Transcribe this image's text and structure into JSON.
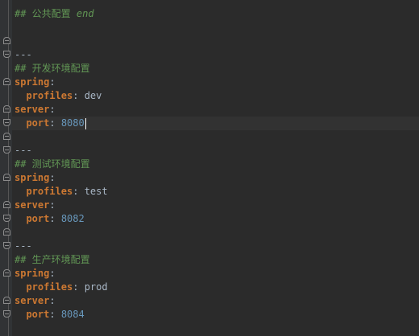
{
  "editor": {
    "lines": [
      {
        "id": "l01",
        "tokens": [
          {
            "cls": "comment",
            "text": "## 公共配置 "
          },
          {
            "cls": "comment-italic",
            "text": "end"
          }
        ]
      },
      {
        "id": "l02",
        "tokens": []
      },
      {
        "id": "l03",
        "tokens": []
      },
      {
        "id": "l04",
        "tokens": [
          {
            "cls": "dash",
            "text": "---"
          }
        ]
      },
      {
        "id": "l05",
        "tokens": [
          {
            "cls": "comment",
            "text": "## 开发环境配置"
          }
        ]
      },
      {
        "id": "l06",
        "tokens": [
          {
            "cls": "key",
            "text": "spring"
          },
          {
            "cls": "plain",
            "text": ":"
          }
        ]
      },
      {
        "id": "l07",
        "tokens": [
          {
            "cls": "plain",
            "text": "  "
          },
          {
            "cls": "key",
            "text": "profiles"
          },
          {
            "cls": "plain",
            "text": ": dev"
          }
        ]
      },
      {
        "id": "l08",
        "tokens": [
          {
            "cls": "key",
            "text": "server"
          },
          {
            "cls": "plain",
            "text": ":"
          }
        ]
      },
      {
        "id": "l09",
        "tokens": [
          {
            "cls": "plain",
            "text": "  "
          },
          {
            "cls": "key",
            "text": "port"
          },
          {
            "cls": "plain",
            "text": ": "
          },
          {
            "cls": "number",
            "text": "8080"
          }
        ],
        "current": true
      },
      {
        "id": "l10",
        "tokens": []
      },
      {
        "id": "l11",
        "tokens": [
          {
            "cls": "dash",
            "text": "---"
          }
        ]
      },
      {
        "id": "l12",
        "tokens": [
          {
            "cls": "comment",
            "text": "## 测试环境配置"
          }
        ]
      },
      {
        "id": "l13",
        "tokens": [
          {
            "cls": "key",
            "text": "spring"
          },
          {
            "cls": "plain",
            "text": ":"
          }
        ]
      },
      {
        "id": "l14",
        "tokens": [
          {
            "cls": "plain",
            "text": "  "
          },
          {
            "cls": "key",
            "text": "profiles"
          },
          {
            "cls": "plain",
            "text": ": test"
          }
        ]
      },
      {
        "id": "l15",
        "tokens": [
          {
            "cls": "key",
            "text": "server"
          },
          {
            "cls": "plain",
            "text": ":"
          }
        ]
      },
      {
        "id": "l16",
        "tokens": [
          {
            "cls": "plain",
            "text": "  "
          },
          {
            "cls": "key",
            "text": "port"
          },
          {
            "cls": "plain",
            "text": ": "
          },
          {
            "cls": "number",
            "text": "8082"
          }
        ]
      },
      {
        "id": "l17",
        "tokens": []
      },
      {
        "id": "l18",
        "tokens": [
          {
            "cls": "dash",
            "text": "---"
          }
        ]
      },
      {
        "id": "l19",
        "tokens": [
          {
            "cls": "comment",
            "text": "## 生产环境配置"
          }
        ]
      },
      {
        "id": "l20",
        "tokens": [
          {
            "cls": "key",
            "text": "spring"
          },
          {
            "cls": "plain",
            "text": ":"
          }
        ]
      },
      {
        "id": "l21",
        "tokens": [
          {
            "cls": "plain",
            "text": "  "
          },
          {
            "cls": "key",
            "text": "profiles"
          },
          {
            "cls": "plain",
            "text": ": prod"
          }
        ]
      },
      {
        "id": "l22",
        "tokens": [
          {
            "cls": "key",
            "text": "server"
          },
          {
            "cls": "plain",
            "text": ":"
          }
        ]
      },
      {
        "id": "l23",
        "tokens": [
          {
            "cls": "plain",
            "text": "  "
          },
          {
            "cls": "key",
            "text": "port"
          },
          {
            "cls": "plain",
            "text": ": "
          },
          {
            "cls": "number",
            "text": "8084"
          }
        ]
      }
    ]
  },
  "colors": {
    "background": "#2b2b2b",
    "gutter": "#313335",
    "comment": "#629755",
    "key": "#cc7832",
    "plain": "#a9b7c6",
    "number": "#6897bb",
    "current_line": "#323232"
  }
}
